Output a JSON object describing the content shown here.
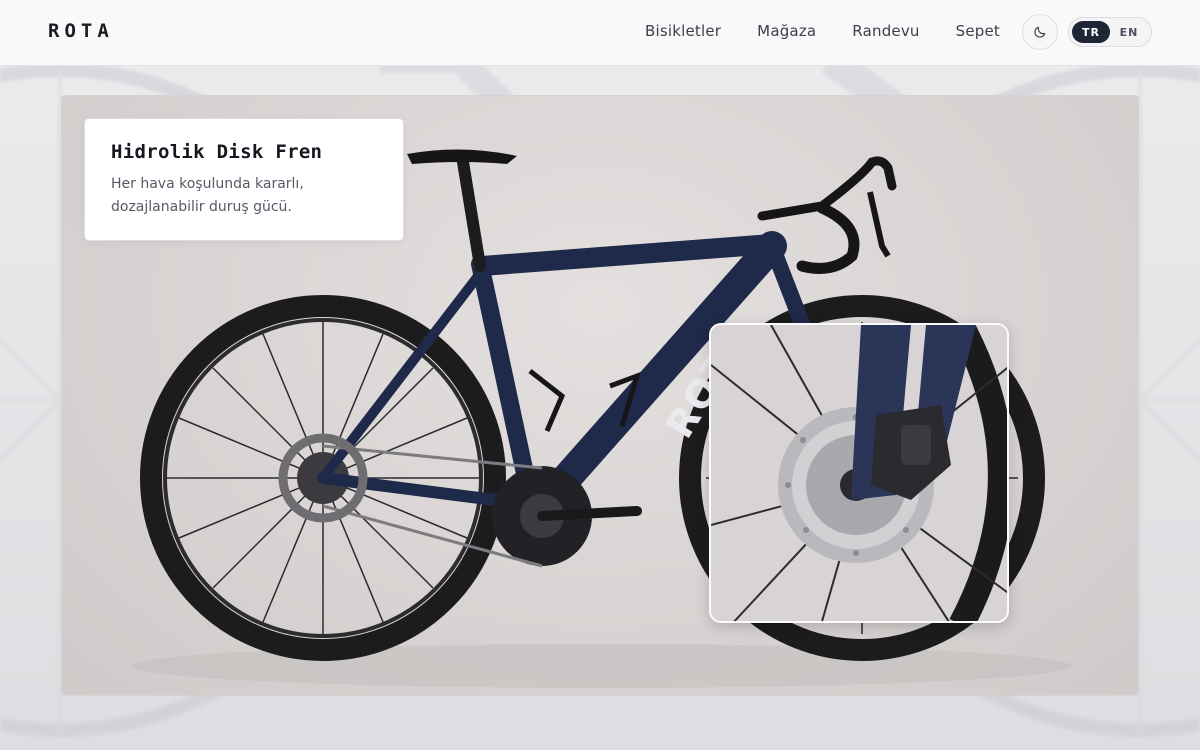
{
  "brand": {
    "logo": "ROTA"
  },
  "nav": {
    "items": [
      {
        "label": "Bisikletler"
      },
      {
        "label": "Mağaza"
      },
      {
        "label": "Randevu"
      },
      {
        "label": "Sepet"
      }
    ]
  },
  "theme_toggle": {
    "icon": "moon-icon"
  },
  "language": {
    "options": [
      "TR",
      "EN"
    ],
    "active": "TR"
  },
  "feature": {
    "title": "Hidrolik Disk Fren",
    "description_line1": "Her hava koşulunda kararlı,",
    "description_line2": "dozajlanabilir duruş gücü."
  },
  "bike": {
    "frame_text": "ROTA",
    "frame_color": "#1f2a4a"
  },
  "colors": {
    "accent": "#1e2537",
    "background": "#e9e9eb"
  }
}
